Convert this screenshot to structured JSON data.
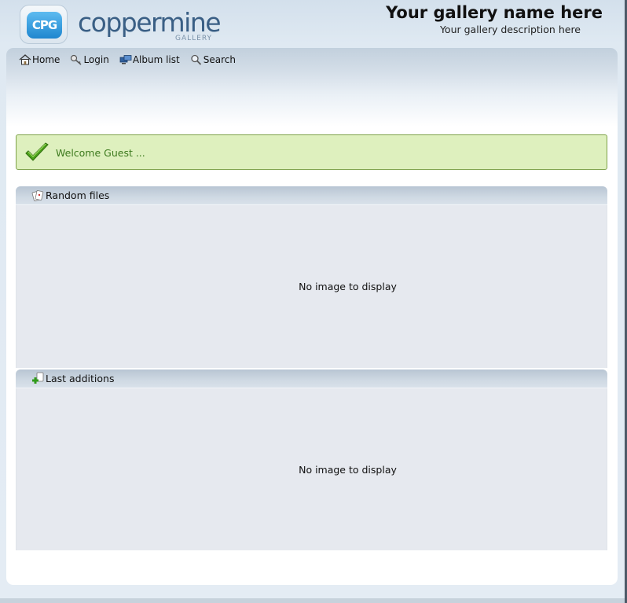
{
  "header": {
    "logo": {
      "badge_text": "CPG",
      "wordmark": "coppermine",
      "subtitle": "GALLERY"
    },
    "gallery_name": "Your gallery name here",
    "gallery_description": "Your gallery description here"
  },
  "nav": {
    "items": [
      {
        "label": "Home",
        "icon": "home-icon"
      },
      {
        "label": "Login",
        "icon": "login-key-icon"
      },
      {
        "label": "Album list",
        "icon": "album-list-icon"
      },
      {
        "label": "Search",
        "icon": "search-icon"
      }
    ]
  },
  "welcome": {
    "message": "Welcome Guest ...",
    "icon": "checkmark-icon"
  },
  "panels": {
    "random": {
      "title": "Random files",
      "icon": "random-files-icon",
      "empty_text": "No image to display"
    },
    "last": {
      "title": "Last additions",
      "icon": "last-additions-icon",
      "empty_text": "No image to display"
    }
  },
  "colors": {
    "welcome_bg": "#def0be",
    "welcome_border": "#7ea24a",
    "welcome_text": "#3d7a1e",
    "logo_accent": "#1f86cf",
    "logo_wordmark": "#3a5f85"
  }
}
